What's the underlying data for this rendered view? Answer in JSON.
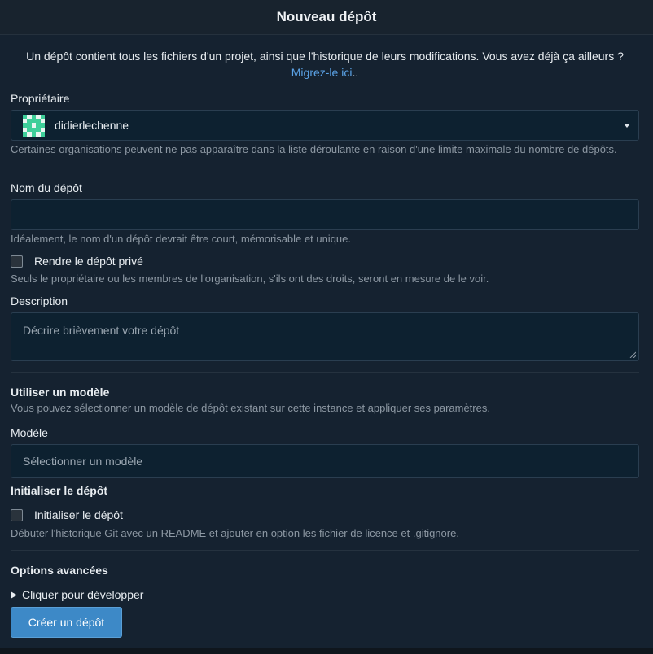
{
  "header": {
    "title": "Nouveau dépôt"
  },
  "intro": {
    "text": "Un dépôt contient tous les fichiers d'un projet, ainsi que l'historique de leurs modifications. Vous avez déjà ça ailleurs ?",
    "link": "Migrez-le ici",
    "suffix": ".."
  },
  "owner": {
    "label": "Propriétaire",
    "value": "didierlechenne",
    "help": "Certaines organisations peuvent ne pas apparaître dans la liste déroulante en raison d'une limite maximale du nombre de dépôts."
  },
  "repo_name": {
    "label": "Nom du dépôt",
    "value": "",
    "placeholder": "",
    "help": "Idéalement, le nom d'un dépôt devrait être court, mémorisable et unique."
  },
  "private": {
    "label": "Rendre le dépôt privé",
    "help": "Seuls le propriétaire ou les membres de l'organisation, s'ils ont des droits, seront en mesure de le voir."
  },
  "description": {
    "label": "Description",
    "placeholder": "Décrire brièvement votre dépôt"
  },
  "template": {
    "section_title": "Utiliser un modèle",
    "section_help": "Vous pouvez sélectionner un modèle de dépôt existant sur cette instance et appliquer ses paramètres.",
    "label": "Modèle",
    "placeholder": "Sélectionner un modèle"
  },
  "init": {
    "section_title": "Initialiser le dépôt",
    "checkbox_label": "Initialiser le dépôt",
    "help": "Débuter l'historique Git avec un README et ajouter en option les fichier de licence et .gitignore."
  },
  "advanced": {
    "section_title": "Options avancées",
    "toggle_label": "Cliquer pour développer"
  },
  "submit": {
    "label": "Créer un dépôt"
  },
  "colors": {
    "accent": "#3d89c7",
    "link": "#5aa2e6",
    "avatar_green": "#3ecf9a"
  }
}
